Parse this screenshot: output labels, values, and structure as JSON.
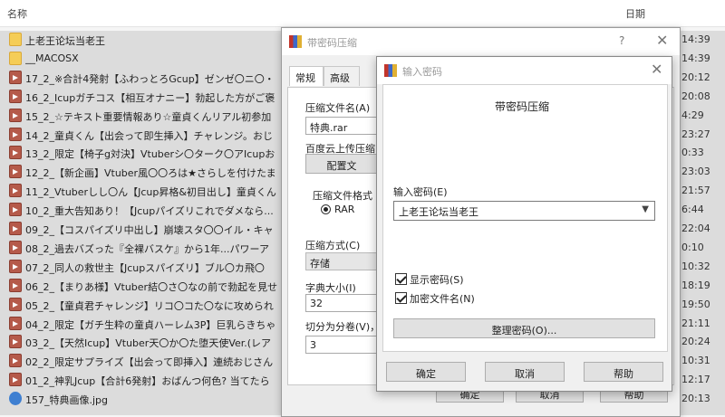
{
  "list": {
    "name_header": "名称",
    "date_header": "日期",
    "rows": [
      {
        "name": "上老王论坛当老王",
        "date": "14:39",
        "icon": "folder-icon"
      },
      {
        "name": "__MACOSX",
        "date": "14:39",
        "icon": "folder-icon"
      },
      {
        "name": "17_2_※合計4発射【ふわっとろGcup】ゼンゼ〇ニ〇・",
        "date": "20:12",
        "icon": "video-file-icon"
      },
      {
        "name": "16_2_Icupガチコス【相互オナニー】勃起した方がご褒",
        "date": "20:08",
        "icon": "video-file-icon"
      },
      {
        "name": "15_2_☆テキスト重要情報あり☆童貞くんリアル初参加",
        "date": "4:29",
        "icon": "video-file-icon"
      },
      {
        "name": "14_2_童貞くん【出会って即生挿入】チャレンジ。おじ",
        "date": "23:27",
        "icon": "video-file-icon"
      },
      {
        "name": "13_2_限定【椅子g対決】Vtuberシ〇ターク〇アIcupお",
        "date": "0:33",
        "icon": "video-file-icon"
      },
      {
        "name": "12_2_【新企画】Vtuber風〇〇ろは★さらしを付けたま",
        "date": "23:03",
        "icon": "video-file-icon"
      },
      {
        "name": "11_2_Vtuberしし〇ん【Jcup昇格&初目出し】童貞くん",
        "date": "21:57",
        "icon": "video-file-icon"
      },
      {
        "name": "10_2_重大告知あり！【Jcupパイズリこれでダメなら...",
        "date": "6:44",
        "icon": "video-file-icon"
      },
      {
        "name": "09_2_【コスパイズリ中出し】崩壊スタ〇〇イル・キャ",
        "date": "22:04",
        "icon": "video-file-icon"
      },
      {
        "name": "08_2_過去バズった『全裸バスケ』から1年...パワーア",
        "date": "0:10",
        "icon": "video-file-icon"
      },
      {
        "name": "07_2_同人の救世主【Jcupスパイズリ】ブル〇カ飛〇",
        "date": "10:32",
        "icon": "video-file-icon"
      },
      {
        "name": "06_2_【まりあ様】Vtuber結〇さ〇なの前で勃起を見せ",
        "date": "18:19",
        "icon": "video-file-icon"
      },
      {
        "name": "05_2_【童貞君チャレンジ】リコ〇コた〇なに攻められ",
        "date": "19:50",
        "icon": "video-file-icon"
      },
      {
        "name": "04_2_限定【ガチ生粋の童貞ハーレム3P】巨乳らきちゃ",
        "date": "21:11",
        "icon": "video-file-icon"
      },
      {
        "name": "03_2_【天然Icup】Vtuber天〇か〇た堕天使Ver.(レア",
        "date": "20:24",
        "icon": "video-file-icon"
      },
      {
        "name": "02_2_限定サプライズ【出会って即挿入】連続おじさん",
        "date": "10:31",
        "icon": "video-file-icon"
      },
      {
        "name": "01_2_神乳Jcup【合計6発射】おばんつ何色? 当てたら",
        "date": "12:17",
        "icon": "video-file-icon"
      },
      {
        "name": "157_特典画像.jpg",
        "date": "20:13",
        "icon": "image-file-icon"
      }
    ]
  },
  "back_dialog": {
    "title": "带密码压缩",
    "help": "?",
    "close": "✕",
    "tabs": [
      "常规",
      "高级"
    ],
    "archive_name_label": "压缩文件名(A)",
    "archive_name_value": "特典.rar",
    "baidu_label": "百度云上传压缩",
    "config_button": "配置文",
    "format_label": "压缩文件格式",
    "format_option": "RAR",
    "method_label": "压缩方式(C)",
    "method_value": "存储",
    "dict_label": "字典大小(I)",
    "dict_value": "32",
    "split_label": "切分为分卷(V)，",
    "split_value": "3",
    "ok": "确定",
    "cancel": "取消",
    "help_button": "帮助"
  },
  "front_dialog": {
    "title": "输入密码",
    "close": "✕",
    "heading": "带密码压缩",
    "password_label": "输入密码(E)",
    "password_value": "上老王论坛当老王",
    "show_password": "显示密码(S)",
    "show_password_checked": true,
    "encrypt_names": "加密文件名(N)",
    "encrypt_names_checked": true,
    "organize_button": "整理密码(O)...",
    "ok": "确定",
    "cancel": "取消",
    "help_button": "帮助"
  }
}
